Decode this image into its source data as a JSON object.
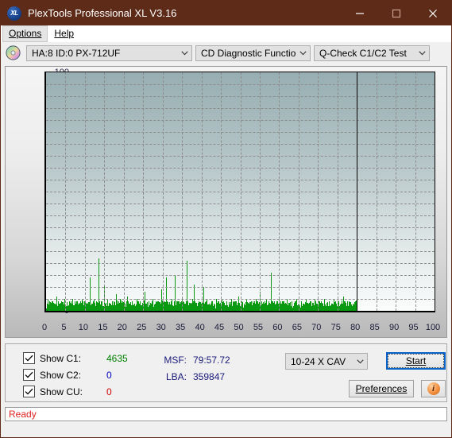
{
  "window": {
    "title": "PlexTools Professional XL V3.16",
    "app_icon": "XL",
    "minimize": "minimize-icon",
    "maximize": "maximize-icon",
    "close": "close-icon",
    "titlebar_color": "#5d2b18"
  },
  "menu": {
    "items": [
      {
        "label": "Options"
      },
      {
        "label": "Help"
      }
    ]
  },
  "toolbar": {
    "disc_icon": "cd-disc-icon",
    "device": "HA:8 ID:0  PX-712UF",
    "function": "CD Diagnostic Functions",
    "test": "Q-Check C1/C2 Test"
  },
  "results": {
    "c1": {
      "label": "Show C1:",
      "value": "4635",
      "color": "#008000",
      "checked": true
    },
    "c2": {
      "label": "Show C2:",
      "value": "0",
      "color": "#0000c0",
      "checked": true
    },
    "cu": {
      "label": "Show CU:",
      "value": "0",
      "color": "#d00000",
      "checked": true
    },
    "msf_key": "MSF:",
    "msf_value": "79:57.72",
    "lba_key": "LBA:",
    "lba_value": "359847",
    "speed": "10-24 X CAV",
    "start_label": "Start",
    "preferences_label": "Preferences",
    "info_label": "i"
  },
  "status": {
    "text": "Ready",
    "color": "#e02020"
  },
  "chart_data": {
    "type": "bar",
    "title": "",
    "xlabel": "",
    "ylabel": "",
    "xlim": [
      0,
      100
    ],
    "ylim": [
      0,
      100
    ],
    "grid": true,
    "legend_position": "none",
    "series_color": "#0a9a12",
    "data_end_marker_x": 80,
    "y_ticks": [
      100,
      95,
      90,
      85,
      80,
      75,
      70,
      65,
      60,
      55,
      50,
      45,
      40,
      35,
      30,
      25,
      20,
      15,
      10,
      5,
      0
    ],
    "x_ticks": [
      0,
      5,
      10,
      15,
      20,
      25,
      30,
      35,
      40,
      45,
      50,
      55,
      60,
      65,
      70,
      75,
      80,
      85,
      90,
      95,
      100
    ],
    "series": [
      {
        "name": "C1",
        "color": "#0a9a12",
        "x": [
          0.2,
          0.5,
          0.8,
          1.1,
          1.4,
          1.7,
          2.0,
          2.3,
          2.6,
          2.9,
          3.2,
          3.5,
          3.8,
          4.1,
          4.4,
          4.7,
          5.0,
          5.3,
          5.6,
          5.9,
          6.2,
          6.5,
          6.8,
          7.1,
          7.4,
          7.7,
          8.0,
          8.3,
          8.6,
          8.9,
          9.2,
          9.5,
          9.8,
          10.1,
          10.4,
          10.7,
          11.0,
          11.3,
          11.6,
          11.9,
          12.2,
          12.5,
          12.8,
          13.1,
          13.4,
          13.7,
          14.0,
          14.3,
          14.6,
          14.9,
          15.2,
          15.5,
          15.8,
          16.1,
          16.4,
          16.7,
          17.0,
          17.3,
          17.6,
          17.9,
          18.2,
          18.5,
          18.8,
          19.1,
          19.4,
          19.7,
          20.0,
          20.3,
          20.6,
          20.9,
          21.2,
          21.5,
          21.8,
          22.1,
          22.4,
          22.7,
          23.0,
          23.3,
          23.6,
          23.9,
          24.2,
          24.5,
          24.8,
          25.1,
          25.4,
          25.7,
          26.0,
          26.3,
          26.6,
          26.9,
          27.2,
          27.5,
          27.8,
          28.1,
          28.4,
          28.7,
          29.0,
          29.3,
          29.6,
          29.9,
          30.2,
          30.5,
          30.8,
          31.1,
          31.4,
          31.7,
          32.0,
          32.3,
          32.6,
          32.9,
          33.2,
          33.5,
          33.8,
          34.1,
          34.4,
          34.7,
          35.0,
          35.3,
          35.6,
          35.9,
          36.2,
          36.5,
          36.8,
          37.1,
          37.4,
          37.7,
          38.0,
          38.3,
          38.6,
          38.9,
          39.2,
          39.5,
          39.8,
          40.1,
          40.4,
          40.7,
          41.0,
          41.3,
          41.6,
          41.9,
          42.2,
          42.5,
          42.8,
          43.1,
          43.4,
          43.7,
          44.0,
          44.3,
          44.6,
          44.9,
          45.2,
          45.5,
          45.8,
          46.1,
          46.4,
          46.7,
          47.0,
          47.3,
          47.6,
          47.9,
          48.2,
          48.5,
          48.8,
          49.1,
          49.4,
          49.7,
          50.0,
          50.3,
          50.6,
          50.9,
          51.2,
          51.5,
          51.8,
          52.1,
          52.4,
          52.7,
          53.0,
          53.3,
          53.6,
          53.9,
          54.2,
          54.5,
          54.8,
          55.1,
          55.4,
          55.7,
          56.0,
          56.3,
          56.6,
          56.9,
          57.2,
          57.5,
          57.8,
          58.1,
          58.4,
          58.7,
          59.0,
          59.3,
          59.6,
          59.9,
          60.2,
          60.5,
          60.8,
          61.1,
          61.4,
          61.7,
          62.0,
          62.3,
          62.6,
          62.9,
          63.2,
          63.5,
          63.8,
          64.1,
          64.4,
          64.7,
          65.0,
          65.3,
          65.6,
          65.9,
          66.2,
          66.5,
          66.8,
          67.1,
          67.4,
          67.7,
          68.0,
          68.3,
          68.6,
          68.9,
          69.2,
          69.5,
          69.8,
          70.1,
          70.4,
          70.7,
          71.0,
          71.3,
          71.6,
          71.9,
          72.2,
          72.5,
          72.8,
          73.1,
          73.4,
          73.7,
          74.0,
          74.3,
          74.6,
          74.9,
          75.2,
          75.5,
          75.8,
          76.1,
          76.4,
          76.7,
          77.0,
          77.3,
          77.6,
          77.9,
          78.2,
          78.5,
          78.8,
          79.1,
          79.4,
          79.7,
          79.9
        ],
        "values": [
          2,
          5,
          3,
          2,
          4,
          2,
          3,
          2,
          6,
          2,
          3,
          2,
          4,
          3,
          2,
          5,
          2,
          3,
          2,
          4,
          2,
          3,
          5,
          2,
          3,
          2,
          4,
          2,
          3,
          2,
          5,
          3,
          2,
          4,
          2,
          3,
          2,
          14,
          3,
          2,
          5,
          2,
          3,
          2,
          22,
          3,
          2,
          4,
          2,
          11,
          3,
          2,
          5,
          2,
          3,
          2,
          4,
          2,
          3,
          7,
          2,
          3,
          2,
          5,
          2,
          4,
          2,
          3,
          2,
          6,
          2,
          3,
          2,
          4,
          2,
          3,
          2,
          5,
          2,
          3,
          4,
          2,
          3,
          2,
          8,
          3,
          2,
          4,
          2,
          3,
          2,
          5,
          2,
          3,
          2,
          4,
          3,
          2,
          9,
          2,
          3,
          2,
          14,
          4,
          2,
          3,
          2,
          5,
          2,
          3,
          15,
          2,
          4,
          2,
          3,
          2,
          6,
          2,
          3,
          2,
          21,
          4,
          2,
          3,
          2,
          5,
          11,
          2,
          3,
          2,
          4,
          2,
          3,
          2,
          10,
          3,
          2,
          5,
          2,
          3,
          2,
          4,
          2,
          3,
          2,
          5,
          2,
          4,
          3,
          2,
          5,
          2,
          3,
          2,
          4,
          2,
          3,
          2,
          5,
          2,
          3,
          2,
          4,
          2,
          6,
          3,
          2,
          4,
          2,
          3,
          2,
          5,
          2,
          3,
          2,
          4,
          2,
          3,
          2,
          5,
          2,
          3,
          2,
          8,
          4,
          2,
          3,
          2,
          5,
          2,
          3,
          2,
          16,
          3,
          2,
          4,
          2,
          3,
          2,
          5,
          2,
          3,
          2,
          4,
          2,
          3,
          5,
          2,
          3,
          2,
          4,
          2,
          3,
          2,
          5,
          2,
          3,
          2,
          4,
          2,
          3,
          2,
          5,
          2,
          3,
          2,
          4,
          2,
          3,
          2,
          5,
          2,
          3,
          2,
          4,
          2,
          3,
          2,
          5,
          2,
          3,
          2,
          4,
          2,
          3,
          2,
          5,
          2,
          3,
          2,
          4,
          2,
          3,
          2,
          6,
          2,
          3,
          2,
          4,
          2,
          3,
          2
        ]
      }
    ]
  }
}
